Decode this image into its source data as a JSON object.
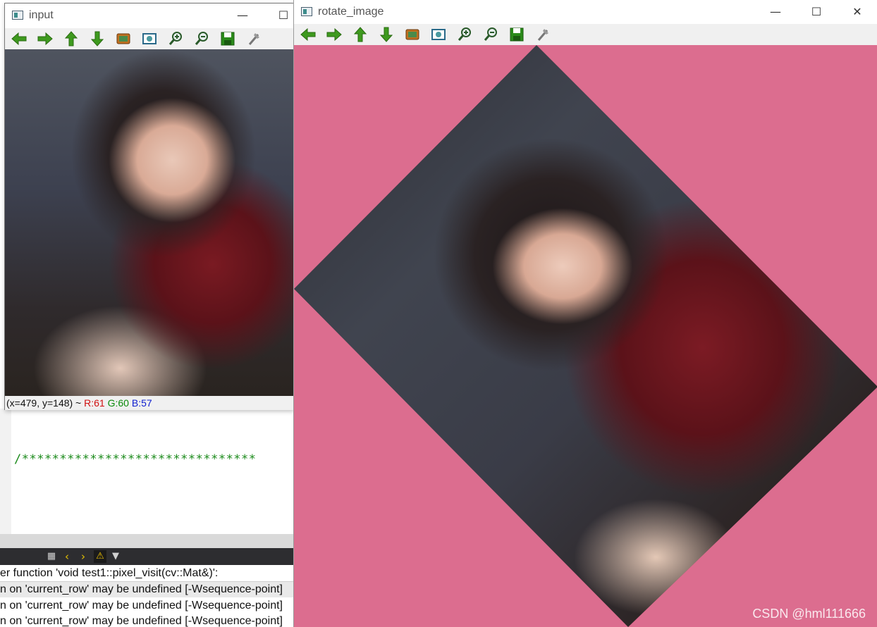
{
  "ide": {
    "code_line": "/*******************************",
    "output_lines": [
      "er function 'void test1::pixel_visit(cv::Mat&)':",
      "n on 'current_row' may be undefined [-Wsequence-point]",
      "n on 'current_row' may be undefined [-Wsequence-point]",
      "n on 'current_row' may be undefined [-Wsequence-point]"
    ],
    "toolbar_icons": [
      "filter-build-icon",
      "chevron-left-icon",
      "chevron-right-icon",
      "warning-icon",
      "filter-icon"
    ]
  },
  "windows": {
    "input": {
      "title": "input",
      "status": {
        "coords": "(x=479, y=148) ~ ",
        "r": "R:61",
        "g": "G:60",
        "b": "B:57"
      }
    },
    "rotate": {
      "title": "rotate_image",
      "background_color": "#dc6d8f"
    }
  },
  "toolbar_buttons": [
    {
      "name": "pan-left-icon",
      "color": "#3e9a1e"
    },
    {
      "name": "pan-right-icon",
      "color": "#3e9a1e"
    },
    {
      "name": "pan-up-icon",
      "color": "#3e9a1e"
    },
    {
      "name": "pan-down-icon",
      "color": "#3e9a1e"
    },
    {
      "name": "zoom-reset-icon",
      "color": "#c07020"
    },
    {
      "name": "zoom-fit-icon",
      "color": "#2a6a8a"
    },
    {
      "name": "zoom-in-icon",
      "color": "#2a5a2a"
    },
    {
      "name": "zoom-out-icon",
      "color": "#2a5a2a"
    },
    {
      "name": "save-icon",
      "color": "#2a8a1a"
    },
    {
      "name": "properties-icon",
      "color": "#777777"
    }
  ],
  "watermark": "CSDN @hml111666"
}
